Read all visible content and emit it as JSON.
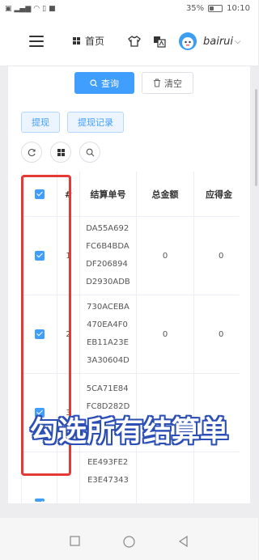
{
  "status_bar": {
    "battery": "35%",
    "time": "10:10",
    "left_icons": [
      "HD",
      "4G",
      "signal",
      "wifi",
      "vibrate",
      "dnd"
    ]
  },
  "header": {
    "home_label": "首页",
    "username": "bairui",
    "icons": [
      "menu-icon",
      "grid-icon",
      "shirt-icon",
      "translate-icon",
      "avatar",
      "chevron-down-icon"
    ]
  },
  "toolbar": {
    "query_label": "查询",
    "clear_label": "清空",
    "withdraw_label": "提现",
    "records_label": "提现记录",
    "icon_buttons": [
      "refresh-icon",
      "columns-icon",
      "search-icon"
    ]
  },
  "table": {
    "columns": [
      "#",
      "结算单号",
      "总金额",
      "应得金"
    ],
    "rows": [
      {
        "index": "1",
        "code": [
          "DA55A692",
          "FC6B4BDA",
          "DF206894",
          "D2930ADB"
        ],
        "total": "0",
        "due": "0",
        "checked": true
      },
      {
        "index": "2",
        "code": [
          "730ACEBA",
          "470EA4F0",
          "EB11A23E",
          "3A30604D"
        ],
        "total": "0",
        "due": "0",
        "checked": true
      },
      {
        "index": "3",
        "code": [
          "5CA71E84",
          "FC8D282D"
        ],
        "total": "",
        "due": "",
        "checked": true
      },
      {
        "index": "",
        "code": [
          "EE493FE2",
          "E3E47343"
        ],
        "total": "",
        "due": "",
        "checked": true
      }
    ]
  },
  "overlay_caption": "勾选所有结算单",
  "colors": {
    "primary": "#409eff",
    "highlight": "#e53935",
    "caption_stroke": "#2c4fb5"
  }
}
